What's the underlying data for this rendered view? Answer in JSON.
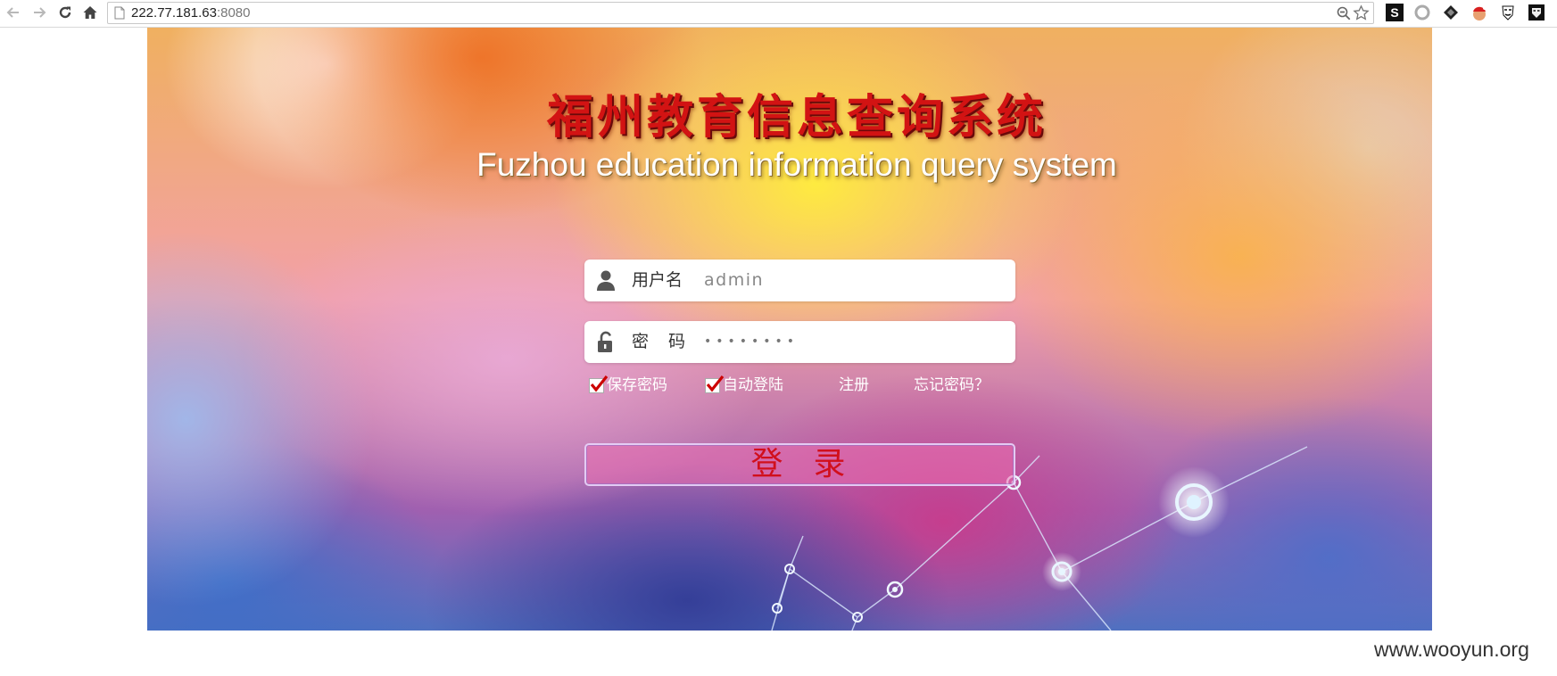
{
  "browser": {
    "url_host": "222.77.181.63",
    "url_port": ":8080",
    "extension_s_label": "S"
  },
  "page": {
    "title_cn": "福州教育信息查询系统",
    "title_en": "Fuzhou education information query system",
    "username": {
      "label": "用户名",
      "value": "admin"
    },
    "password": {
      "label": "密码",
      "value": "••••••••"
    },
    "options": {
      "save_password": "保存密码",
      "auto_login": "自动登陆",
      "register": "注册",
      "forgot_password": "忘记密码？"
    },
    "login_button": "登录"
  },
  "watermark": "www.wooyun.org",
  "colors": {
    "title_red": "#d21313",
    "login_text_red": "#d10f1c",
    "check_red": "#cc0000"
  }
}
